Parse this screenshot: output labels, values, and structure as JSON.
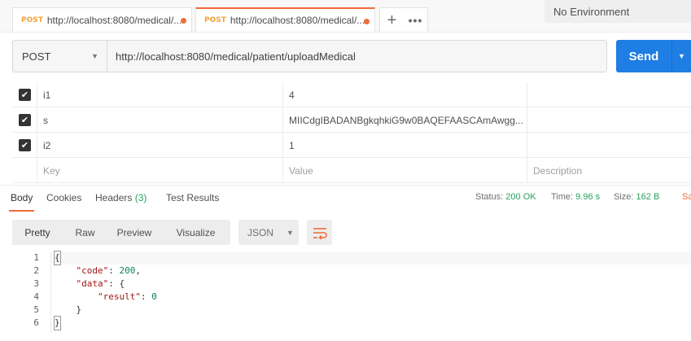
{
  "tabs": [
    {
      "method": "POST",
      "url": "http://localhost:8080/medical/..."
    },
    {
      "method": "POST",
      "url": "http://localhost:8080/medical/..."
    }
  ],
  "environment": "No Environment",
  "request": {
    "method": "POST",
    "url": "http://localhost:8080/medical/patient/uploadMedical",
    "send_label": "Send"
  },
  "params": {
    "rows": [
      {
        "key": "i1",
        "value": "4",
        "description": ""
      },
      {
        "key": "s",
        "value": "MIICdgIBADANBgkqhkiG9w0BAQEFAASCAmAwgg...",
        "description": ""
      },
      {
        "key": "i2",
        "value": "1",
        "description": ""
      }
    ],
    "placeholder": {
      "key": "Key",
      "value": "Value",
      "description": "Description"
    }
  },
  "response": {
    "tabs": {
      "body": "Body",
      "cookies": "Cookies",
      "headers": "Headers",
      "headers_count": "(3)",
      "tests": "Test Results"
    },
    "status_label": "Status:",
    "status_value": "200 OK",
    "time_label": "Time:",
    "time_value": "9.96 s",
    "size_label": "Size:",
    "size_value": "162 B",
    "save_label": "Sa",
    "views": [
      "Pretty",
      "Raw",
      "Preview",
      "Visualize"
    ],
    "format": "JSON",
    "code_lines": [
      "1",
      "2",
      "3",
      "4",
      "5",
      "6"
    ],
    "body": {
      "open": "{",
      "code_key": "\"code\"",
      "code_val": "200",
      "data_key": "\"data\"",
      "result_key": "\"result\"",
      "result_val": "0",
      "inner_close": "}",
      "close": "}"
    }
  }
}
